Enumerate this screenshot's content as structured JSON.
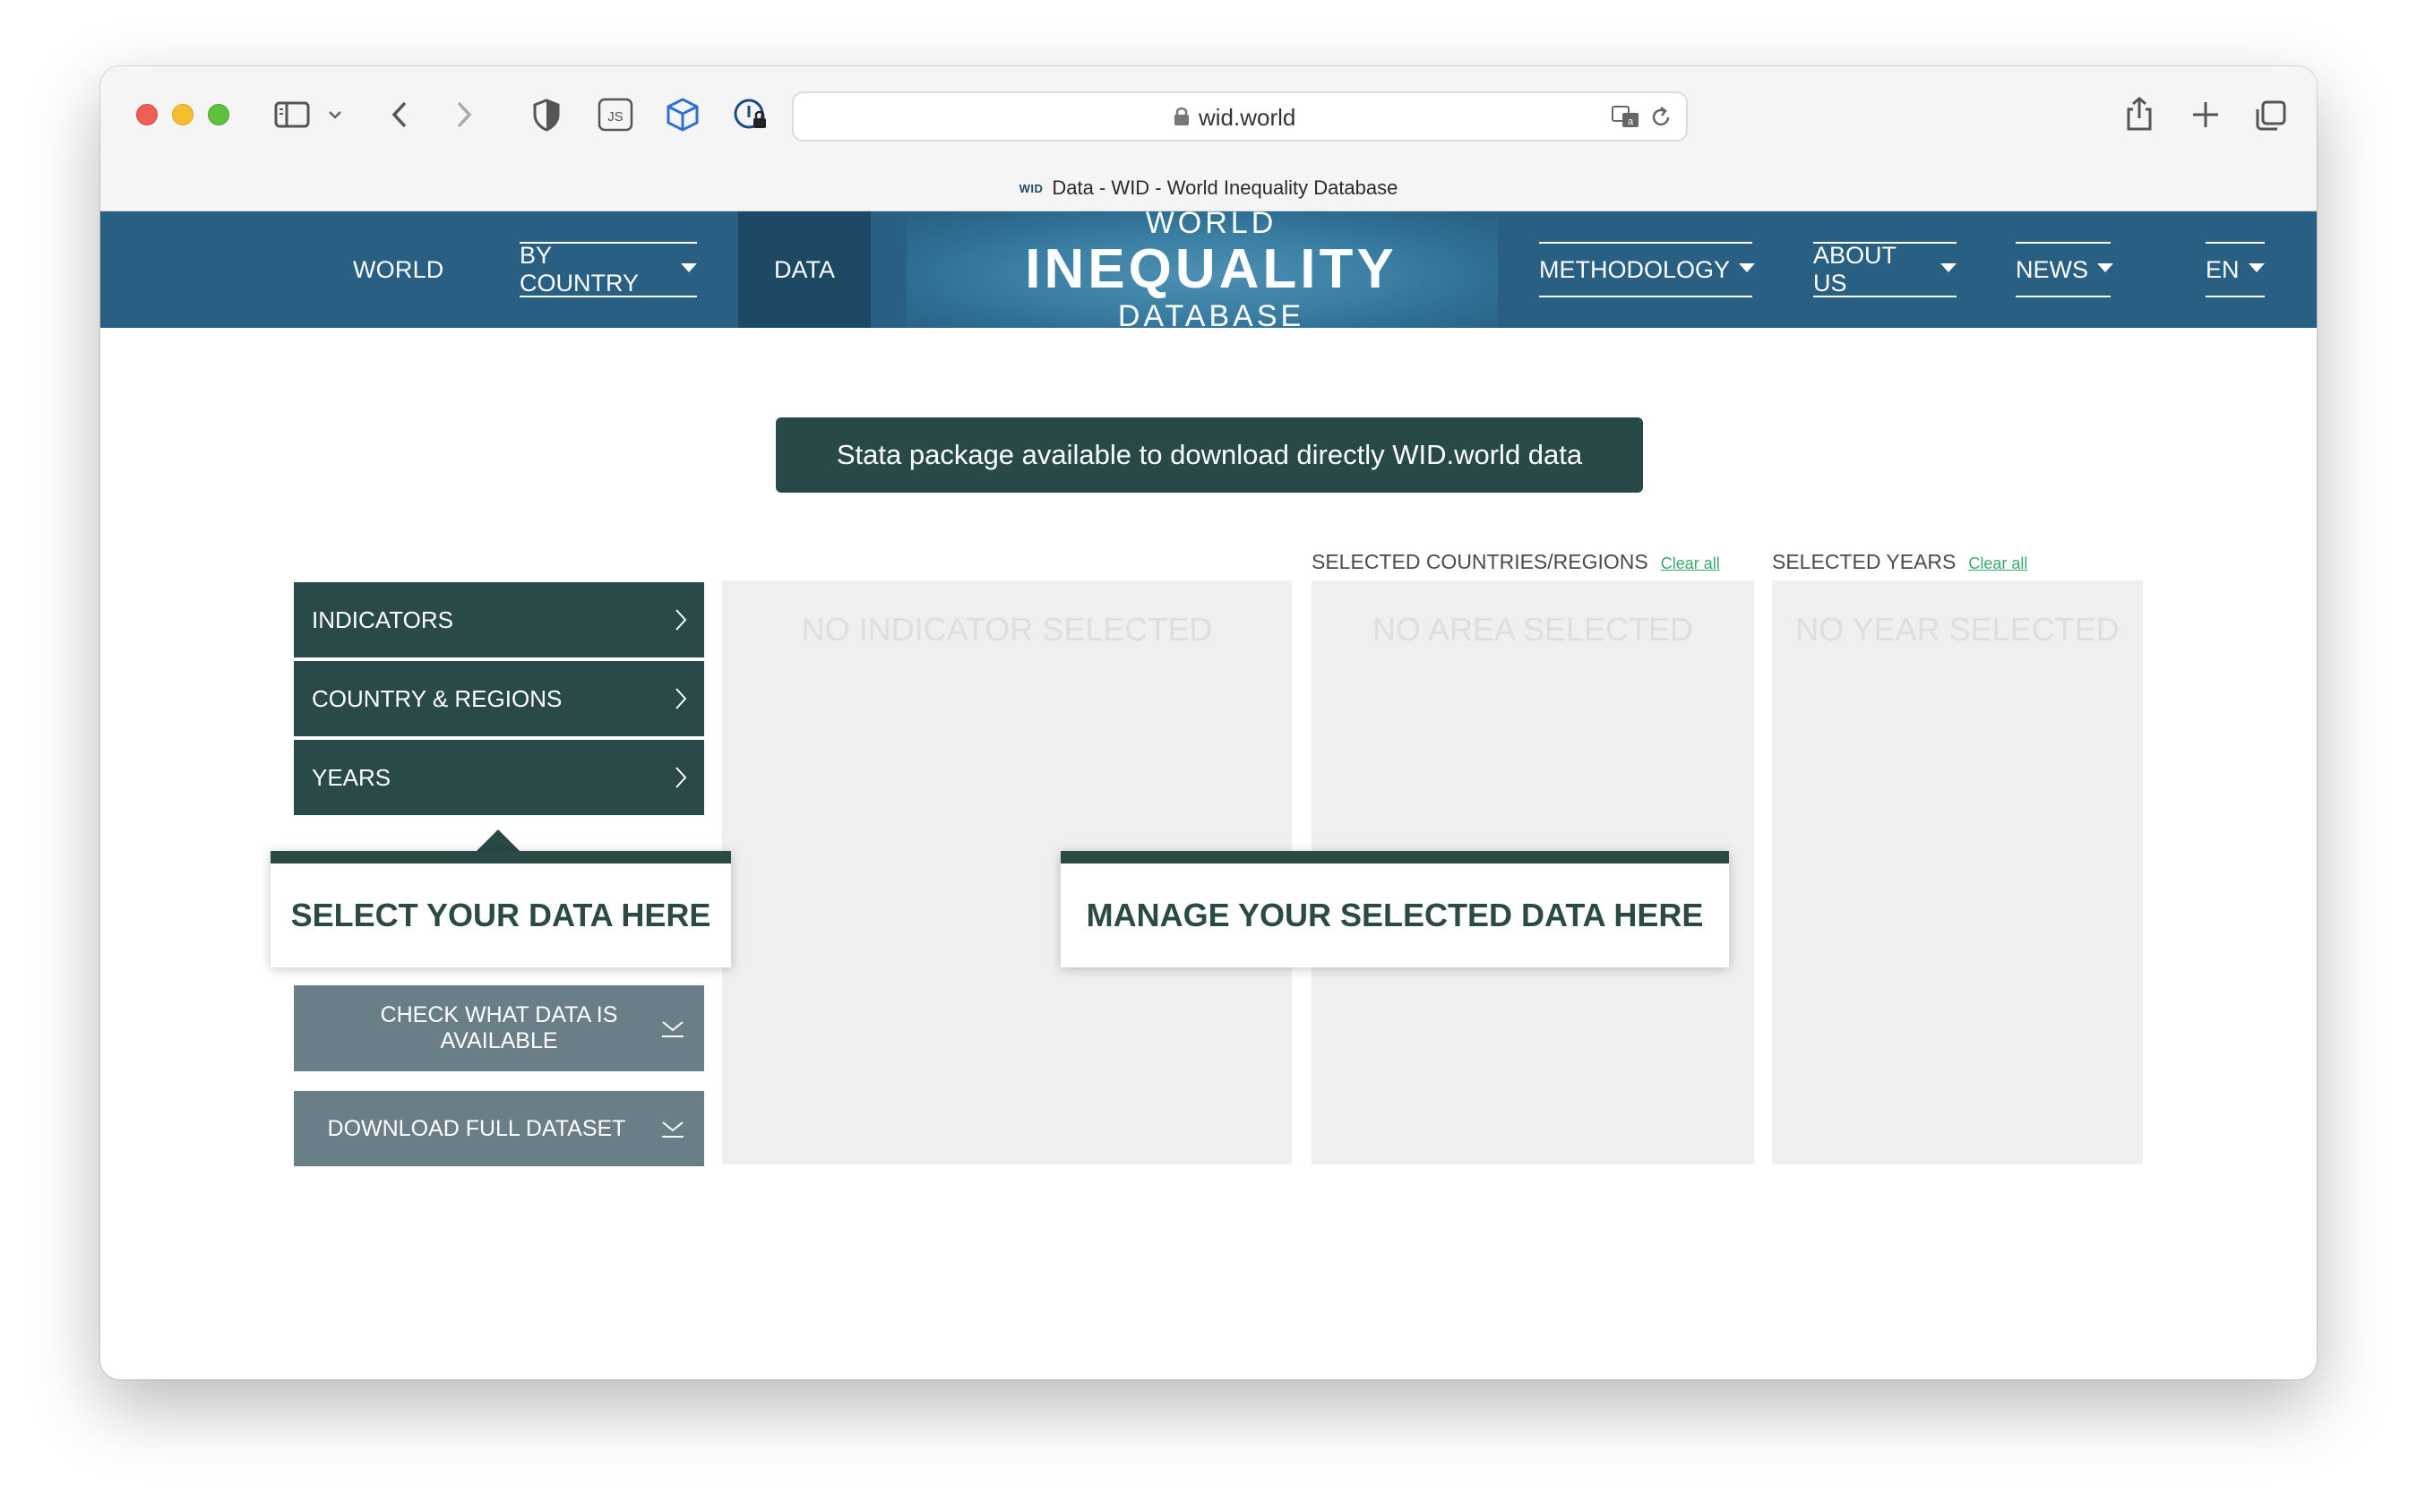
{
  "browser": {
    "url": "wid.world",
    "tab_favicon": "WID",
    "tab_title": "Data - WID - World Inequality Database",
    "js_badge": "JS"
  },
  "nav": {
    "world": "WORLD",
    "by_country": "BY COUNTRY",
    "data": "DATA",
    "logo_top": "WORLD",
    "logo_main": "INEQUALITY",
    "logo_bottom": "DATABASE",
    "methodology": "METHODOLOGY",
    "about_us": "ABOUT US",
    "news": "NEWS",
    "language": "EN"
  },
  "banner": {
    "text": "Stata package available to download directly WID.world data"
  },
  "selector": {
    "indicators": "INDICATORS",
    "countries": "COUNTRY & REGIONS",
    "years": "YEARS",
    "check_data": "CHECK WHAT DATA IS AVAILABLE",
    "download_full": "DOWNLOAD FULL DATASET"
  },
  "panels": {
    "indicator_empty": "NO INDICATOR SELECTED",
    "countries_title": "SELECTED COUNTRIES/REGIONS",
    "countries_clear": "Clear all",
    "area_empty": "NO AREA SELECTED",
    "years_title": "SELECTED YEARS",
    "years_clear": "Clear all",
    "year_empty": "NO YEAR SELECTED"
  },
  "callouts": {
    "select": "SELECT YOUR DATA HERE",
    "manage": "MANAGE YOUR SELECTED DATA HERE"
  },
  "colors": {
    "nav_bg": "#285f82",
    "nav_active": "#1d4964",
    "menu_dark": "#294a48",
    "menu_gray": "#6a7e88",
    "panel_bg": "#efefef",
    "link_green": "#3aa96a"
  }
}
